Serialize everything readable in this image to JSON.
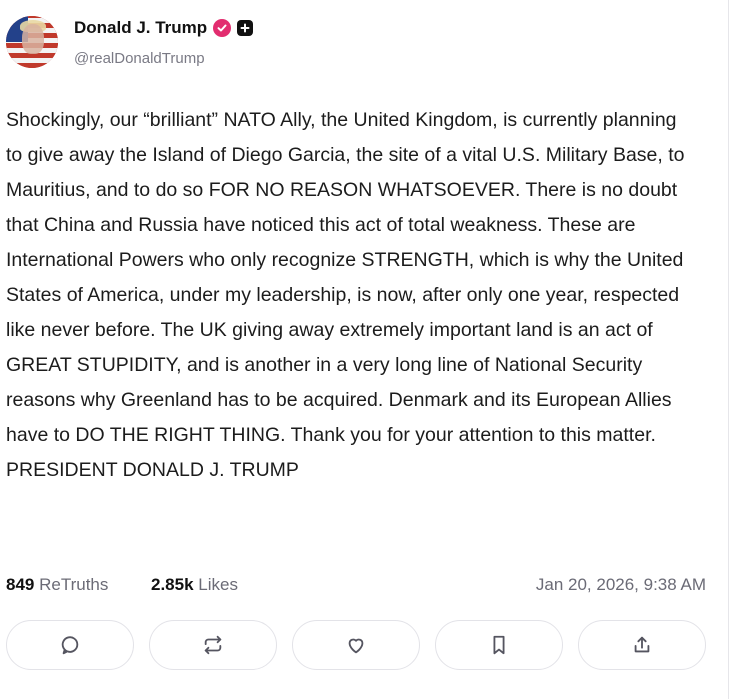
{
  "author": {
    "display_name": "Donald J. Trump",
    "handle": "@realDonaldTrump",
    "verified_icon": "verified-badge-icon",
    "plus_icon": "plus-badge-icon"
  },
  "post": {
    "text": "Shockingly, our “brilliant” NATO Ally, the United Kingdom, is currently planning to give away the Island of Diego Garcia, the site of a vital U.S. Military Base, to Mauritius, and to do so FOR NO REASON WHATSOEVER. There is no doubt that China and Russia have noticed this act of total weakness. These are International Powers who only recognize STRENGTH, which is why the United States of America, under my leadership, is now, after only one year, respected like never before. The UK giving away extremely important land is an act of GREAT STUPIDITY, and is another in a very long line of National Security reasons why Greenland has to be acquired. Denmark and its European Allies have to DO THE RIGHT THING. Thank you for your attention to this matter. PRESIDENT DONALD J. TRUMP"
  },
  "stats": {
    "retruths_count": "849",
    "retruths_label": "ReTruths",
    "likes_count": "2.85k",
    "likes_label": "Likes",
    "timestamp": "Jan 20, 2026, 9:38 AM"
  },
  "actions": [
    {
      "name": "reply",
      "icon": "comment-icon"
    },
    {
      "name": "retruth",
      "icon": "repost-icon"
    },
    {
      "name": "like",
      "icon": "heart-icon"
    },
    {
      "name": "bookmark",
      "icon": "bookmark-icon"
    },
    {
      "name": "share",
      "icon": "share-icon"
    }
  ],
  "colors": {
    "verified": "#e22d6f",
    "muted_text": "#6b6b76",
    "border": "#e3e3e8"
  }
}
